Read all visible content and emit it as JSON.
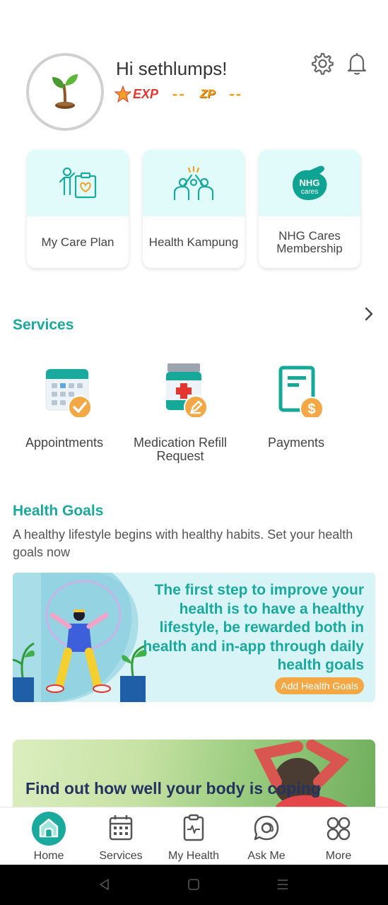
{
  "profile": {
    "greeting": "Hi sethlumps!",
    "exp_label": "EXP",
    "exp_value": "--",
    "zp_label": "ZP",
    "zp_value": "--"
  },
  "header_icons": [
    "gear-icon",
    "bell-icon"
  ],
  "quick_tiles": [
    {
      "label": "My Care Plan",
      "icon": "care-plan-icon"
    },
    {
      "label": "Health Kampung",
      "icon": "community-icon"
    },
    {
      "label": "NHG Cares Membership",
      "icon": "nhg-cares-icon",
      "icon_text_1": "NHG",
      "icon_text_2": "cares"
    }
  ],
  "services": {
    "title": "Services",
    "items": [
      {
        "label": "Appointments",
        "icon": "calendar-check-icon"
      },
      {
        "label": "Medication Refill Request",
        "icon": "medicine-bottle-icon"
      },
      {
        "label": "Payments",
        "icon": "bill-dollar-icon"
      }
    ]
  },
  "health_goals": {
    "title": "Health Goals",
    "description": "A healthy lifestyle begins with healthy habits. Set your health goals now",
    "banner_text": "The first step to improve your health is to have a healthy lifestyle, be rewarded both in health and in-app through daily health goals",
    "button_label": "Add Health Goals"
  },
  "promo_card": {
    "text": "Find out how well your body is coping"
  },
  "bottom_nav": [
    {
      "label": "Home",
      "icon": "home-icon",
      "active": true
    },
    {
      "label": "Services",
      "icon": "calendar-icon",
      "active": false
    },
    {
      "label": "My Health",
      "icon": "health-clipboard-icon",
      "active": false
    },
    {
      "label": "Ask Me",
      "icon": "chat-bubble-icon",
      "active": false
    },
    {
      "label": "More",
      "icon": "grid-icon",
      "active": false
    }
  ],
  "colors": {
    "accent": "#1aa99d",
    "tile_bg": "#e1fafa",
    "orange": "#f3a845",
    "exp_red": "#e4362f"
  }
}
